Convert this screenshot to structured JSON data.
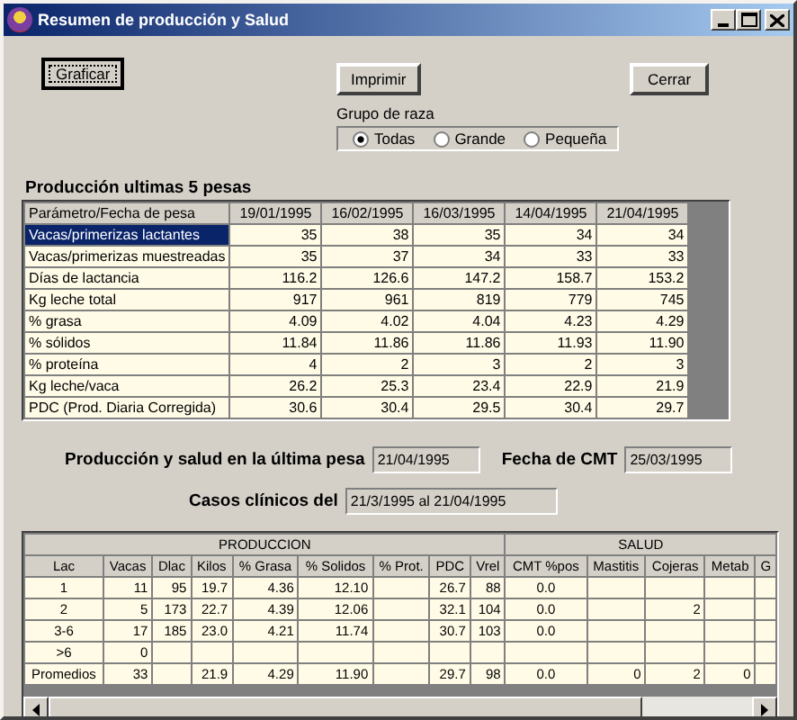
{
  "window": {
    "title": "Resumen de producción y Salud"
  },
  "buttons": [
    {
      "label": "Graficar",
      "focused": true
    },
    {
      "label": "Imprimir",
      "focused": false
    },
    {
      "label": "Cerrar",
      "focused": false
    }
  ],
  "breed_group": {
    "label": "Grupo de raza",
    "options": [
      {
        "label": "Todas",
        "selected": true
      },
      {
        "label": "Grande",
        "selected": false
      },
      {
        "label": "Pequeña",
        "selected": false
      }
    ]
  },
  "production": {
    "title": "Producción ultimas 5 pesas",
    "columns": [
      "Parámetro/Fecha de pesa",
      "19/01/1995",
      "16/02/1995",
      "16/03/1995",
      "14/04/1995",
      "21/04/1995"
    ],
    "rows": [
      {
        "selected": true,
        "cells": [
          "Vacas/primerizas lactantes",
          "35",
          "38",
          "35",
          "34",
          "34"
        ]
      },
      {
        "selected": false,
        "cells": [
          "Vacas/primerizas muestreadas",
          "35",
          "37",
          "34",
          "33",
          "33"
        ]
      },
      {
        "selected": false,
        "cells": [
          "Días de lactancia",
          "116.2",
          "126.6",
          "147.2",
          "158.7",
          "153.2"
        ]
      },
      {
        "selected": false,
        "cells": [
          "Kg leche total",
          "917",
          "961",
          "819",
          "779",
          "745"
        ]
      },
      {
        "selected": false,
        "cells": [
          "% grasa",
          "4.09",
          "4.02",
          "4.04",
          "4.23",
          "4.29"
        ]
      },
      {
        "selected": false,
        "cells": [
          "% sólidos",
          "11.84",
          "11.86",
          "11.86",
          "11.93",
          "11.90"
        ]
      },
      {
        "selected": false,
        "cells": [
          "% proteína",
          "4",
          "2",
          "3",
          "2",
          "3"
        ]
      },
      {
        "selected": false,
        "cells": [
          "Kg leche/vaca",
          "26.2",
          "25.3",
          "23.4",
          "22.9",
          "21.9"
        ]
      },
      {
        "selected": false,
        "cells": [
          "PDC (Prod. Diaria Corregida)",
          "30.6",
          "30.4",
          "29.5",
          "30.4",
          "29.7"
        ]
      }
    ]
  },
  "last_weighing": {
    "label": "Producción y salud en la última pesa",
    "value": "21/04/1995"
  },
  "cmt_date": {
    "label": "Fecha de CMT",
    "value": "25/03/1995"
  },
  "clinical_cases": {
    "label": "Casos clínicos del",
    "value": "21/3/1995 al 21/04/1995"
  },
  "summary": {
    "groups": [
      {
        "label": "PRODUCCION",
        "columns": [
          "Lac",
          "Vacas",
          "Dlac",
          "Kilos",
          "% Grasa",
          "% Solidos",
          "% Prot.",
          "PDC",
          "Vrel"
        ]
      },
      {
        "label": "SALUD",
        "columns": [
          "CMT %pos",
          "Mastitis",
          "Cojeras",
          "Metab",
          "G"
        ]
      }
    ],
    "rows": [
      [
        "1",
        "11",
        "95",
        "19.7",
        "4.36",
        "12.10",
        null,
        "26.7",
        "88",
        "0.0",
        null,
        null,
        null,
        null
      ],
      [
        "2",
        "5",
        "173",
        "22.7",
        "4.39",
        "12.06",
        null,
        "32.1",
        "104",
        "0.0",
        null,
        "2",
        null,
        null
      ],
      [
        "3-6",
        "17",
        "185",
        "23.0",
        "4.21",
        "11.74",
        null,
        "30.7",
        "103",
        "0.0",
        null,
        null,
        null,
        null
      ],
      [
        ">6",
        "0",
        null,
        null,
        null,
        null,
        null,
        null,
        null,
        null,
        null,
        null,
        null,
        null
      ],
      [
        "Promedios",
        "33",
        null,
        "21.9",
        "4.29",
        "11.90",
        null,
        "29.7",
        "98",
        "0.0",
        "0",
        "2",
        "0",
        null
      ]
    ]
  }
}
